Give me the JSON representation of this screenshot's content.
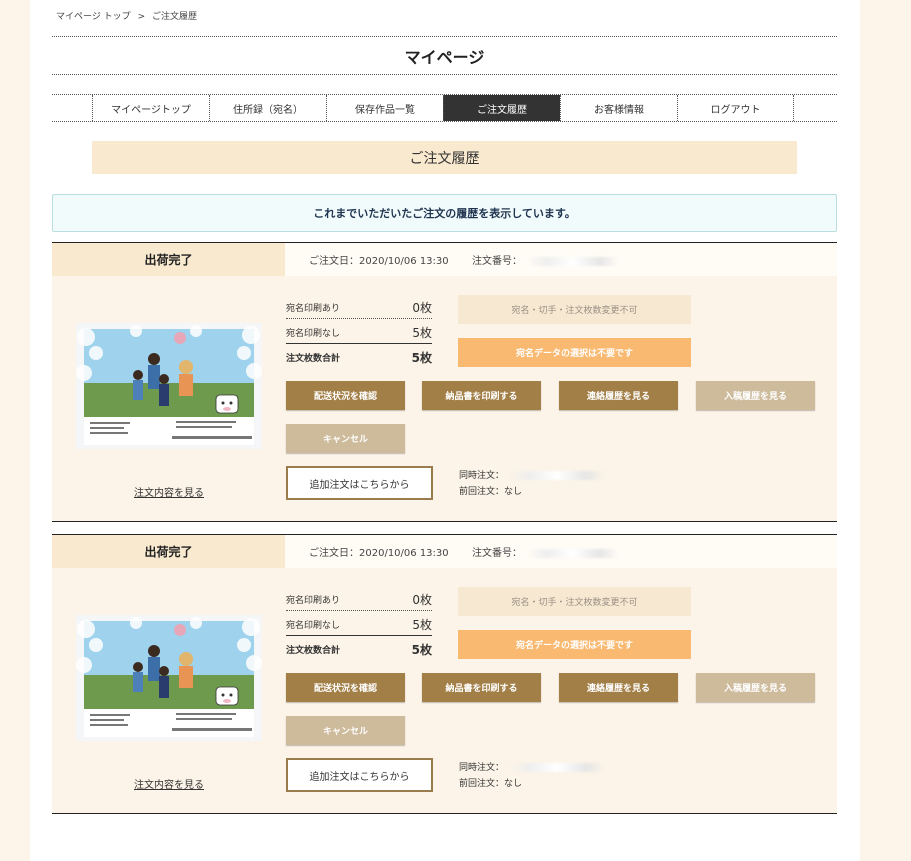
{
  "breadcrumb": {
    "home": "マイページ トップ",
    "sep": ">",
    "current": "ご注文履歴"
  },
  "page_title": "マイページ",
  "nav": [
    "マイページトップ",
    "住所録（宛名）",
    "保存作品一覧",
    "ご注文履歴",
    "お客様情報",
    "ログアウト"
  ],
  "section_title": "ご注文履歴",
  "notice": "これまでいただいたご注文の履歴を表示しています。",
  "orders": [
    {
      "status": "出荷完了",
      "date": "ご注文日：2020/10/06 13:30",
      "number_label": "注文番号：",
      "rows": [
        {
          "label": "宛名印刷あり",
          "value": "0枚"
        },
        {
          "label": "宛名印刷なし",
          "value": "5枚"
        },
        {
          "label": "注文枚数合計",
          "value": "5枚"
        }
      ],
      "nochange": "宛名・切手・注文枚数変更不可",
      "address_select": "宛名データの選択は不要です",
      "btn_shipping": "配送状況を確認",
      "btn_invoice": "納品書を印刷する",
      "btn_contact": "連絡履歴を見る",
      "btn_submit": "入稿履歴を見る",
      "btn_cancel": "キャンセル",
      "add_order": "追加注文はこちらから",
      "same_order": "同時注文：",
      "prev_order": "前回注文：なし",
      "view_link": "注文内容を見る"
    },
    {
      "status": "出荷完了",
      "date": "ご注文日：2020/10/06 13:30",
      "number_label": "注文番号：",
      "rows": [
        {
          "label": "宛名印刷あり",
          "value": "0枚"
        },
        {
          "label": "宛名印刷なし",
          "value": "5枚"
        },
        {
          "label": "注文枚数合計",
          "value": "5枚"
        }
      ],
      "nochange": "宛名・切手・注文枚数変更不可",
      "address_select": "宛名データの選択は不要です",
      "btn_shipping": "配送状況を確認",
      "btn_invoice": "納品書を印刷する",
      "btn_contact": "連絡履歴を見る",
      "btn_submit": "入稿履歴を見る",
      "btn_cancel": "キャンセル",
      "add_order": "追加注文はこちらから",
      "same_order": "同時注文：",
      "prev_order": "前回注文：なし",
      "view_link": "注文内容を見る"
    }
  ]
}
